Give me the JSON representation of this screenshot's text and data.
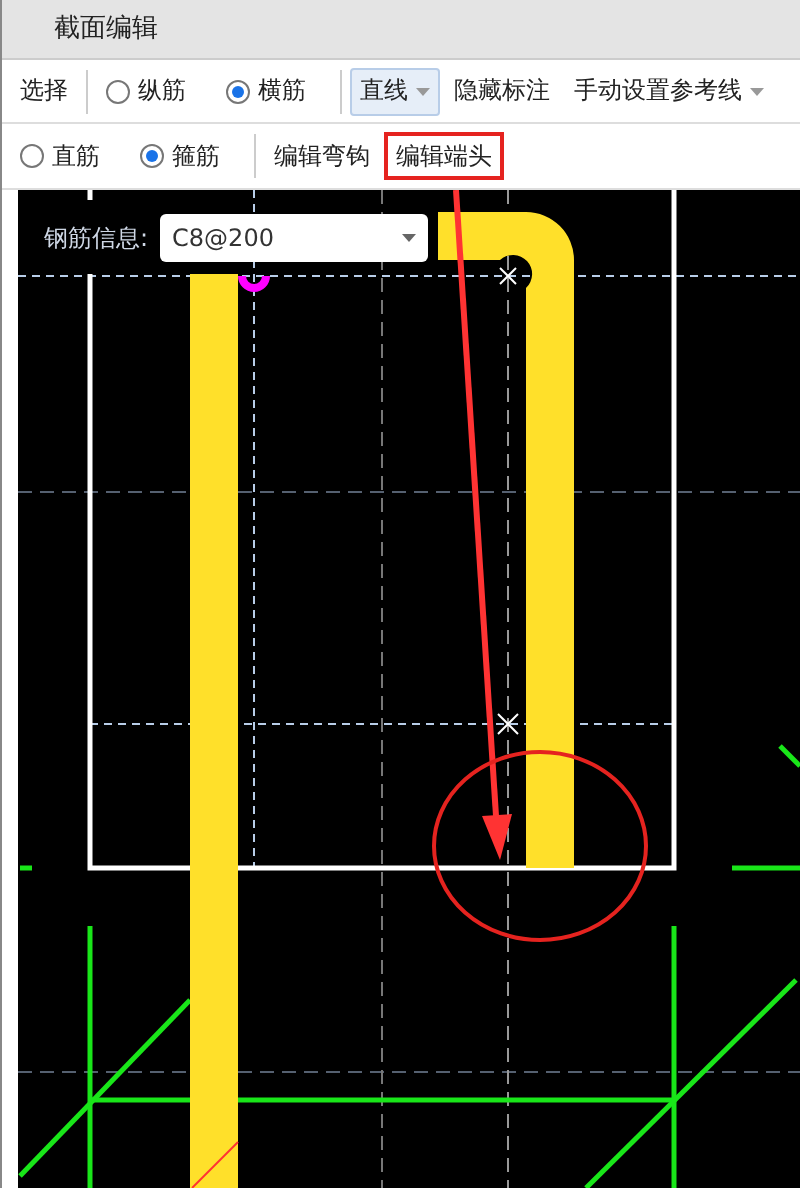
{
  "window": {
    "title": "截面编辑"
  },
  "toolbar": [
    {
      "kind": "button",
      "label": "选择"
    },
    {
      "kind": "radio",
      "label": "纵筋",
      "selected": false
    },
    {
      "kind": "radio",
      "label": "横筋",
      "selected": true
    },
    {
      "kind": "dropdown",
      "label": "直线",
      "highlighted": true
    },
    {
      "kind": "button",
      "label": "隐藏标注"
    },
    {
      "kind": "dropdown",
      "label": "手动设置参考线",
      "highlighted": false
    }
  ],
  "toolbar_2": [
    {
      "kind": "radio",
      "label": "直筋",
      "selected": false
    },
    {
      "kind": "radio",
      "label": "箍筋",
      "selected": true
    },
    {
      "kind": "button",
      "label": "编辑弯钩",
      "annotated": false
    },
    {
      "kind": "button",
      "label": "编辑端头",
      "annotated": true
    }
  ],
  "rebar_info": {
    "label": "钢筋信息:",
    "value": "C8@200"
  }
}
